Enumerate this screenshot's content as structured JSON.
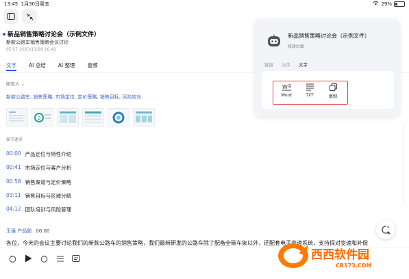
{
  "status": {
    "time": "13:45",
    "date": "1月30日周五",
    "battery": "29%"
  },
  "doc": {
    "title": "新品销售策略讨论会（示例文件）",
    "subtitle": "新款公路车销售策略会议讨论",
    "meta": "05:57  2023/11/28 16:42"
  },
  "tabs": [
    "文字",
    "AI 总结",
    "AI 整理",
    "音频"
  ],
  "speaker_filter": "所有人",
  "keywords": "新款公路车, 销售策略, 市场定位, 定价策略, 销售目标, 风险应对",
  "chapters_title": "章节速览",
  "chapters": [
    {
      "time": "00:00",
      "label": "产品定位与特性介绍"
    },
    {
      "time": "00:41",
      "label": "市场定位与客户分析"
    },
    {
      "time": "00:58",
      "label": "销售渠道与定价策略"
    },
    {
      "time": "03:11",
      "label": "销售目标与区域分解"
    },
    {
      "time": "04:12",
      "label": "团队培训与风险管理"
    }
  ],
  "speaker": {
    "name": "王强 产品部",
    "time": "00:00"
  },
  "transcript": "各位，今天的会议主要讨论我们的新款公路车的销售策略，我们最新研发的公路车除了配备全碳车架以外，还配套电子变速系统，支持探对变速和补偿",
  "panel": {
    "title": "新品销售策略讨论会（示例文件）",
    "subtitle": "修改封面",
    "tabs": [
      "链接",
      "文件",
      "文字"
    ],
    "exports": [
      {
        "label": "Word",
        "icon": "word-icon"
      },
      {
        "label": "TXT",
        "icon": "txt-icon"
      },
      {
        "label": "复制",
        "icon": "copy-icon"
      }
    ]
  },
  "watermark": {
    "text": "西西软件园",
    "url": "CR173.COM"
  },
  "colors": {
    "accent": "#2b5bd7",
    "highlight": "#e33d3d"
  }
}
